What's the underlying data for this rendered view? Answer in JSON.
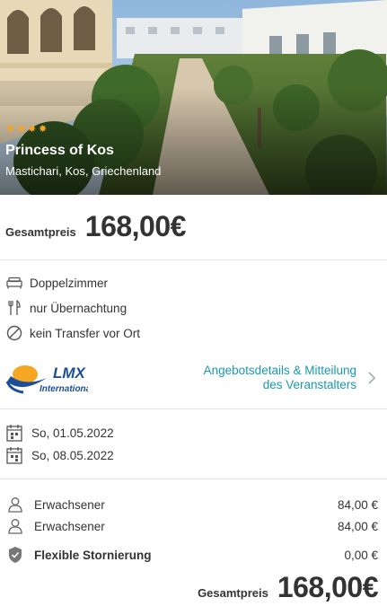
{
  "hotel": {
    "stars": 4,
    "name": "Princess of Kos",
    "location": "Mastichari, Kos, Griechenland"
  },
  "price": {
    "label": "Gesamtpreis",
    "value": "168,00€"
  },
  "features": [
    {
      "icon": "bed-icon",
      "label": "Doppelzimmer"
    },
    {
      "icon": "cutlery-icon",
      "label": "nur Übernachtung"
    },
    {
      "icon": "no-transfer-icon",
      "label": "kein Transfer vor Ort"
    }
  ],
  "operator": {
    "logo_text": "LMX",
    "logo_subtext": "International",
    "link_line1": "Angebotsdetails & Mitteilung",
    "link_line2": "des Veranstalters"
  },
  "dates": {
    "start": "So, 01.05.2022",
    "end": "So, 08.05.2022"
  },
  "travellers": [
    {
      "label": "Erwachsener",
      "price": "84,00 €"
    },
    {
      "label": "Erwachsener",
      "price": "84,00 €"
    }
  ],
  "cancellation": {
    "label": "Flexible Stornierung",
    "price": "0,00 €"
  },
  "total": {
    "label": "Gesamtpreis",
    "value": "168,00€"
  },
  "colors": {
    "accent_link": "#1a9aae",
    "star": "#f3a52b",
    "logo_blue": "#1b4e9a",
    "logo_orange": "#f5a623"
  }
}
